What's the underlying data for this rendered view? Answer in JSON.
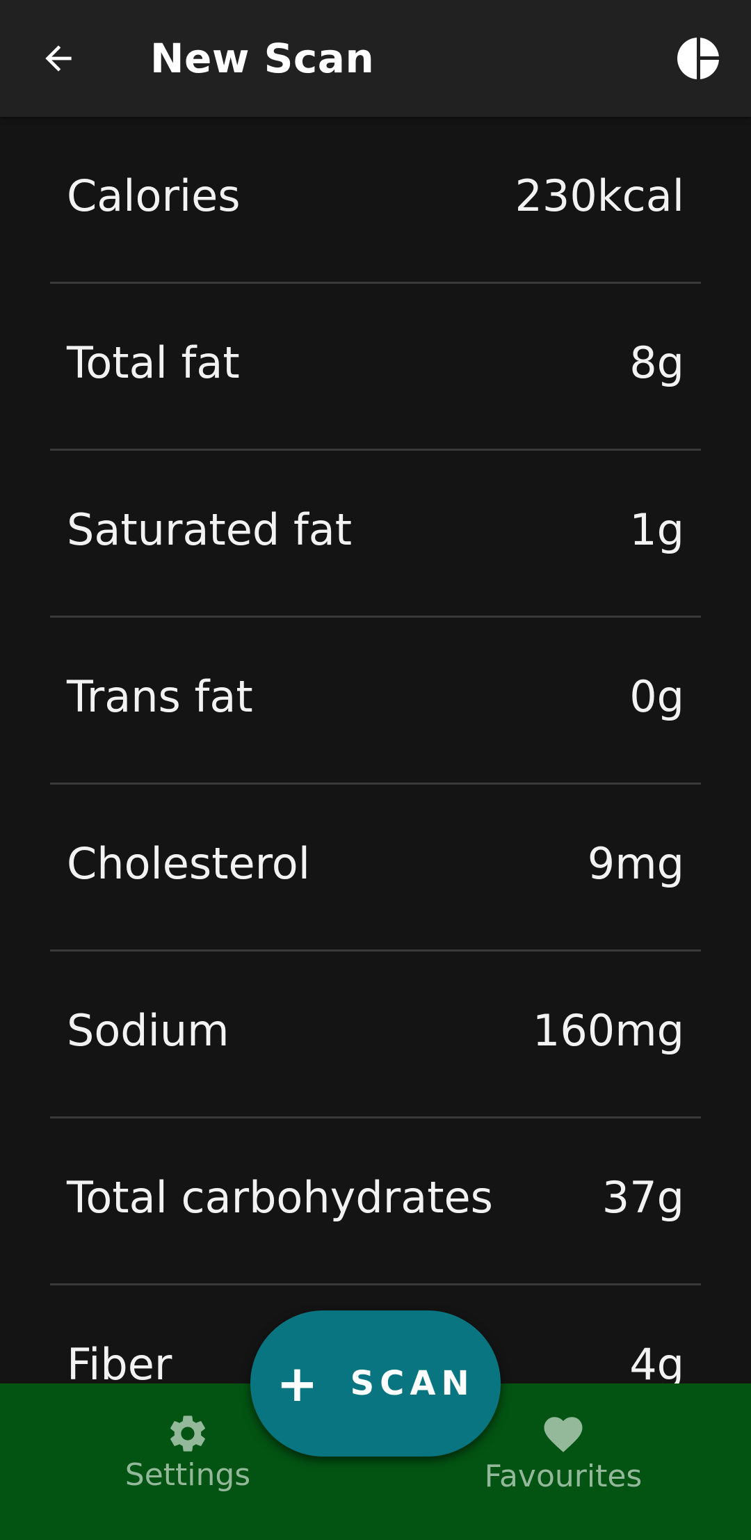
{
  "header": {
    "title": "New Scan",
    "back_icon": "arrow-back-icon",
    "chart_icon": "pie-chart-icon"
  },
  "nutrition": {
    "rows": [
      {
        "label": "Calories",
        "value": "230kcal"
      },
      {
        "label": "Total fat",
        "value": "8g"
      },
      {
        "label": "Saturated fat",
        "value": "1g"
      },
      {
        "label": "Trans fat",
        "value": "0g"
      },
      {
        "label": "Cholesterol",
        "value": "9mg"
      },
      {
        "label": "Sodium",
        "value": "160mg"
      },
      {
        "label": "Total carbohydrates",
        "value": "37g"
      },
      {
        "label": "Fiber",
        "value": "4g"
      }
    ]
  },
  "fab": {
    "icon": "plus-icon",
    "plus_glyph": "+",
    "label": "SCAN"
  },
  "bottom_nav": {
    "settings_label": "Settings",
    "settings_icon": "gear-icon",
    "favourites_label": "Favourites",
    "favourites_icon": "heart-icon"
  },
  "colors": {
    "background": "#141414",
    "topbar": "#212121",
    "nav_bar": "#035413",
    "fab": "#087581",
    "nav_text": "#93b89a"
  }
}
